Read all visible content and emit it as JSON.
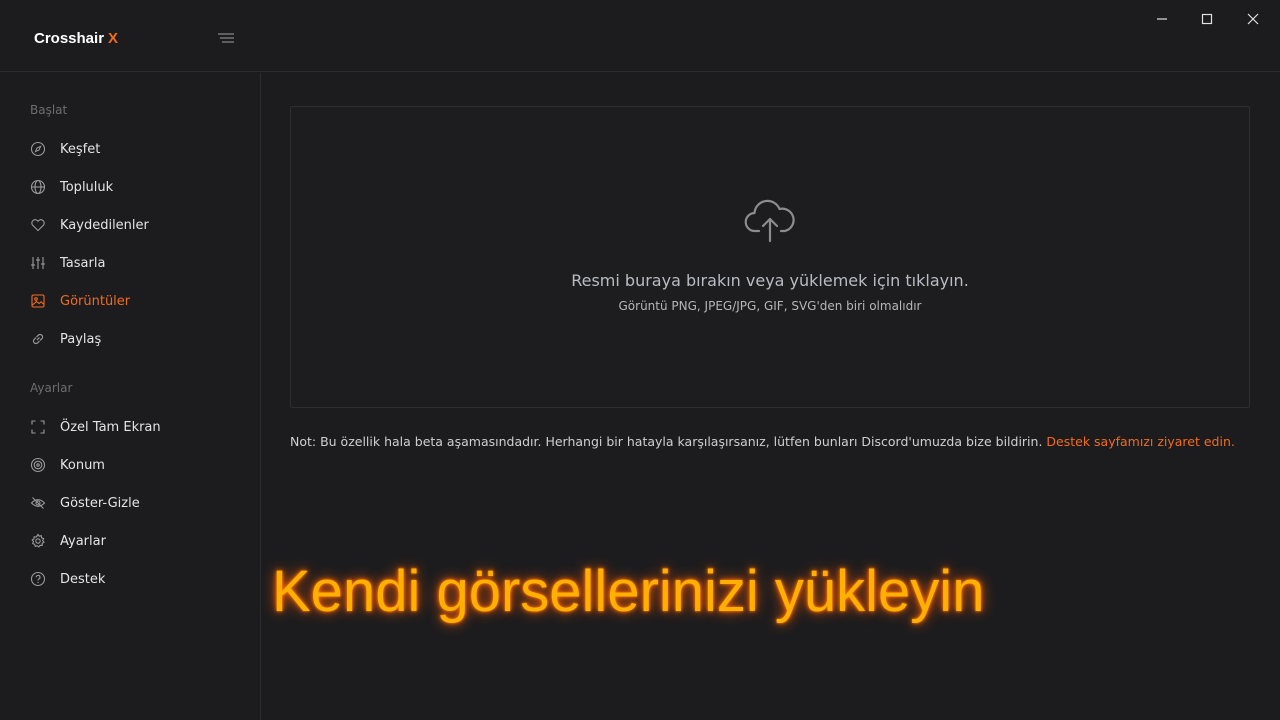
{
  "app": {
    "brand": "Crosshair",
    "brand_accent": "X"
  },
  "colors": {
    "accent": "#f26b1d",
    "background": "#1c1c1e",
    "caption": "#ffb000"
  },
  "sidebar": {
    "sections": [
      {
        "label": "Başlat"
      },
      {
        "label": "Ayarlar"
      }
    ],
    "items": [
      {
        "label": "Keşfet",
        "icon": "compass-icon"
      },
      {
        "label": "Topluluk",
        "icon": "globe-icon"
      },
      {
        "label": "Kaydedilenler",
        "icon": "heart-icon"
      },
      {
        "label": "Tasarla",
        "icon": "sliders-icon"
      },
      {
        "label": "Görüntüler",
        "icon": "image-icon",
        "active": true
      },
      {
        "label": "Paylaş",
        "icon": "link-icon"
      },
      {
        "label": "Özel Tam Ekran",
        "icon": "fullscreen-icon"
      },
      {
        "label": "Konum",
        "icon": "target-icon"
      },
      {
        "label": "Göster-Gizle",
        "icon": "eye-off-icon"
      },
      {
        "label": "Ayarlar",
        "icon": "gear-icon"
      },
      {
        "label": "Destek",
        "icon": "help-icon"
      }
    ]
  },
  "main": {
    "dropzone": {
      "icon": "cloud-upload-icon",
      "title": "Resmi buraya bırakın veya yüklemek için tıklayın.",
      "subtitle": "Görüntü PNG, JPEG/JPG, GIF, SVG'den biri olmalıdır"
    },
    "note": {
      "text": "Not: Bu özellik hala beta aşamasındadır. Herhangi bir hatayla karşılaşırsanız, lütfen bunları Discord'umuzda bize bildirin. ",
      "link": "Destek sayfamızı ziyaret edin."
    }
  },
  "overlay": {
    "caption": "Kendi görsellerinizi yükleyin"
  }
}
